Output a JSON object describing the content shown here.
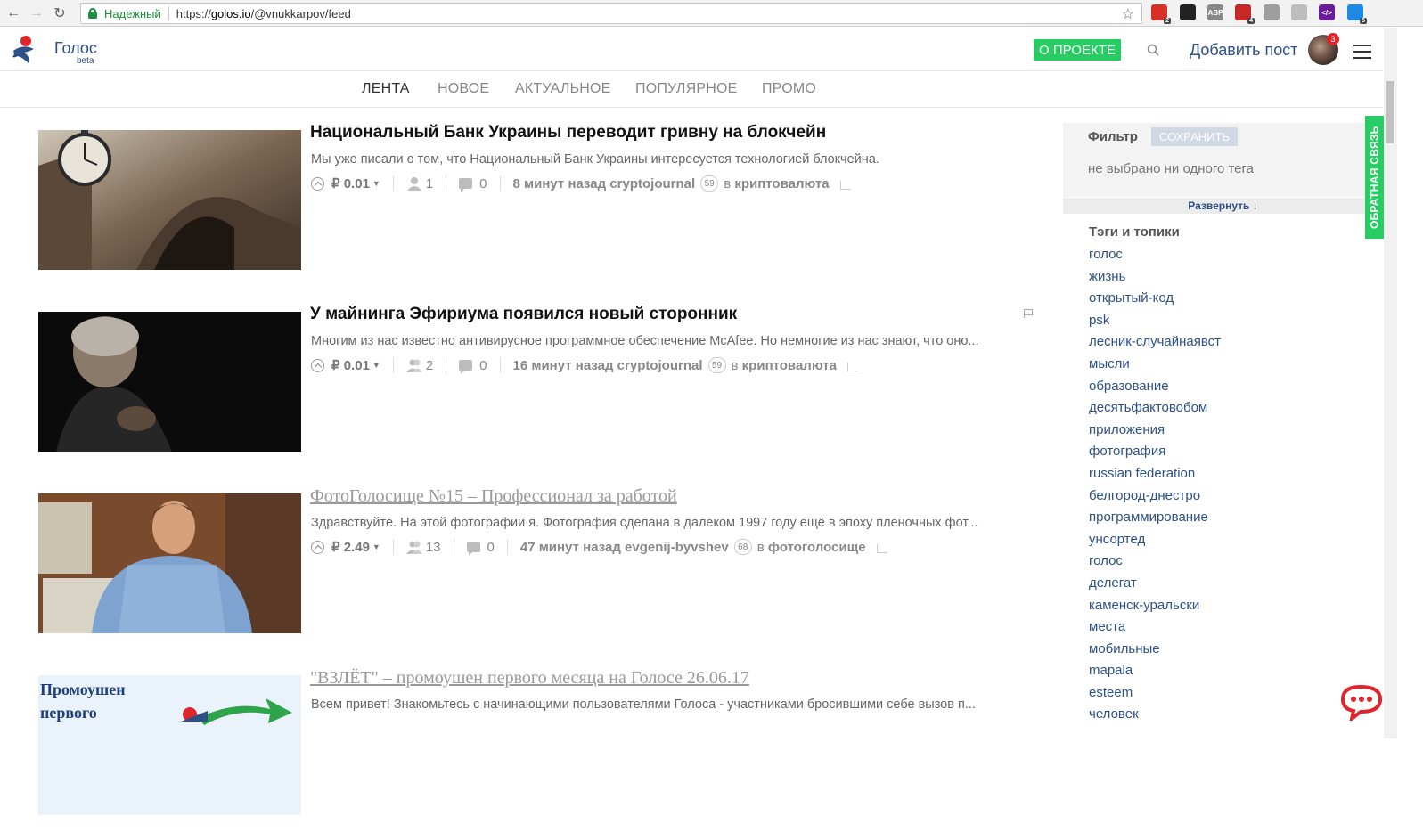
{
  "browser": {
    "secure_label": "Надежный",
    "url_prefix": "https://",
    "url_host": "golos.io",
    "url_path": "/@vnukkarpov/feed",
    "extensions": [
      {
        "name": "gmail",
        "badge": "2",
        "color": "#d93025"
      },
      {
        "name": "ninja",
        "badge": "",
        "color": "#222222"
      },
      {
        "name": "abp",
        "badge": "",
        "color": "#888888",
        "text": "ABP"
      },
      {
        "name": "red-box",
        "badge": "4",
        "color": "#c62828"
      },
      {
        "name": "puzzle",
        "badge": "",
        "color": "#9e9e9e"
      },
      {
        "name": "leaf",
        "badge": "",
        "color": "#bdbdbd"
      },
      {
        "name": "code",
        "badge": "",
        "color": "#6a1b9a",
        "text": "</>"
      },
      {
        "name": "translate",
        "badge": "5",
        "color": "#1e88e5"
      }
    ]
  },
  "header": {
    "brand": "Голос",
    "beta": "beta",
    "about_button": "О ПРОЕКТЕ",
    "add_post": "Добавить пост",
    "notification_count": "3"
  },
  "tabs": [
    {
      "label": "ЛЕНТА",
      "active": true
    },
    {
      "label": "НОВОЕ",
      "active": false
    },
    {
      "label": "АКТУАЛЬНОЕ",
      "active": false
    },
    {
      "label": "ПОПУЛЯРНОЕ",
      "active": false
    },
    {
      "label": "ПРОМО",
      "active": false
    }
  ],
  "posts": [
    {
      "title": "Национальный Банк Украины переводит гривну на блокчейн",
      "excerpt": "Мы уже писали о том, что Национальный Банк Украины интересуется технологией блокчейна.",
      "payout": "₽ 0.01",
      "voters": "1",
      "comments": "0",
      "time": "8 минут назад",
      "author": "cryptojournal",
      "reputation": "59",
      "in_label": "в",
      "category": "криптовалюта"
    },
    {
      "title": "У майнинга Эфириума появился новый сторонник",
      "excerpt": "Многим из нас известно антивирусное программное обеспечение McAfee. Но немногие из нас знают, что оно...",
      "payout": "₽ 0.01",
      "voters": "2",
      "comments": "0",
      "time": "16 минут назад",
      "author": "cryptojournal",
      "reputation": "59",
      "in_label": "в",
      "category": "криптовалюта"
    },
    {
      "title": "ФотоГолосище №15 – Профессионал за работой",
      "excerpt": "Здравствуйте. На этой фотографии я. Фотография сделана в далеком 1997 году ещё в эпоху пленочных фот...",
      "payout": "₽ 2.49",
      "voters": "13",
      "comments": "0",
      "time": "47 минут назад",
      "author": "evgenij-byvshev",
      "reputation": "68",
      "in_label": "в",
      "category": "фотоголосище"
    },
    {
      "title": "\"ВЗЛЁТ\" – промоушен первого месяца на Голосе 26.06.17",
      "excerpt": "Всем привет! Знакомьтесь с начинающими пользователями Голоса - участниками бросившими себе вызов п...",
      "thumb_text_line1": "Промоушен",
      "thumb_text_line2": "первого"
    }
  ],
  "sidebar": {
    "filter_label": "Фильтр",
    "save_button": "СОХРАНИТЬ",
    "no_tags": "не выбрано ни одного тега",
    "expand": "Развернуть ↓",
    "tags_title": "Тэги и топики",
    "tags": [
      "голос",
      "жизнь",
      "открытый-код",
      "psk",
      "лесник-случайнаявст",
      "мысли",
      "образование",
      "десятьфактовобом",
      "приложения",
      "фотография",
      "russian federation",
      "белгород-днестро",
      "программирование",
      "унсортед",
      "голос",
      "делегат",
      "каменск-уральски",
      "места",
      "мобильные",
      "mapala",
      "esteem",
      "человек"
    ]
  },
  "feedback_label": "ОБРАТНАЯ СВЯЗЬ"
}
